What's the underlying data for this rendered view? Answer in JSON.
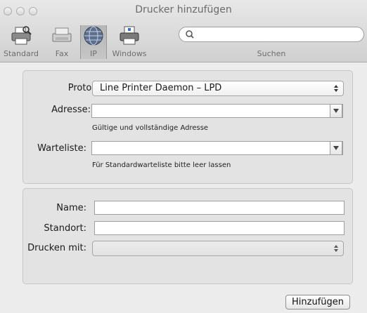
{
  "window": {
    "title": "Drucker hinzufügen"
  },
  "toolbar": {
    "items": [
      {
        "label": "Standard",
        "icon": "default-printer-icon"
      },
      {
        "label": "Fax",
        "icon": "fax-icon"
      },
      {
        "label": "IP",
        "icon": "globe-icon",
        "selected": true
      },
      {
        "label": "Windows",
        "icon": "windows-printer-icon"
      }
    ],
    "search": {
      "label": "Suchen",
      "value": "",
      "placeholder": ""
    }
  },
  "ip_settings": {
    "protocol_label": "Protokoll:",
    "protocol_value": "Line Printer Daemon – LPD",
    "address_label": "Adresse:",
    "address_value": "",
    "address_hint": "Gültige und vollständige Adresse",
    "queue_label": "Warteliste:",
    "queue_value": "",
    "queue_hint": "Für Standardwarteliste bitte leer lassen"
  },
  "printer_info": {
    "name_label": "Name:",
    "name_value": "",
    "location_label": "Standort:",
    "location_value": "",
    "driver_label": "Drucken mit:",
    "driver_value": ""
  },
  "actions": {
    "add_label": "Hinzufügen"
  }
}
